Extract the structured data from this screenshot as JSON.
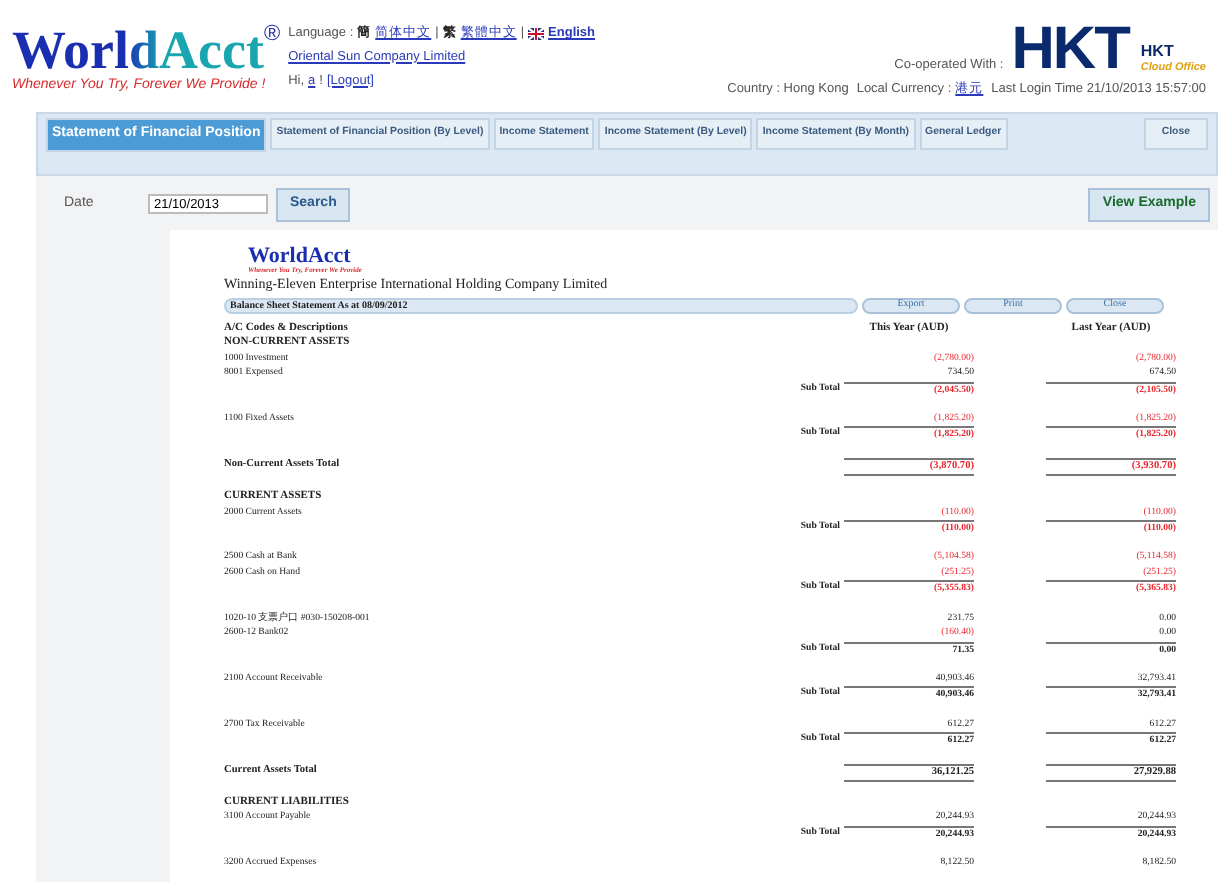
{
  "header": {
    "logo": "WorldAcct",
    "logo_mark": "®",
    "tagline": "Whenever You Try, Forever We Provide !",
    "language_label": "Language :",
    "languages": [
      {
        "glyph": "簡",
        "label": "简体中文",
        "selected": false
      },
      {
        "separator": "|",
        "glyph": "繁",
        "label": "繁體中文",
        "selected": false
      },
      {
        "separator": "|",
        "label": "English",
        "selected": true
      }
    ],
    "company": "Oriental Sun Company Limited",
    "greeting": "Hi,",
    "user": "a",
    "greeting_end": "!",
    "logout": "[Logout]",
    "cooperated": "Co-operated With :",
    "partner_logo": "HKT",
    "partner_sub": "HKT",
    "partner_sub2": "Cloud Office",
    "country": "Country : Hong Kong",
    "currency_label": "Local Currency :",
    "currency": "港元",
    "last_login": "Last Login Time 21/10/2013 15:57:00"
  },
  "tabs": [
    {
      "label": "Statement of Financial Position",
      "selected": true
    },
    {
      "label": "Statement of Financial Position (By Level)",
      "selected": false
    },
    {
      "label": "Income Statement",
      "selected": false
    },
    {
      "label": "Income Statement (By Level)",
      "selected": false
    },
    {
      "label": "Income Statement (By Month)",
      "selected": false
    },
    {
      "label": "General Ledger",
      "selected": false
    }
  ],
  "close_tab": "Close",
  "filter": {
    "label": "Date",
    "value": "21/10/2013",
    "search": "Search",
    "example": "View Example"
  },
  "report": {
    "logo": "WorldAcct",
    "tagline": "Whenever You Try, Forever We Provide",
    "company": "Winning-Eleven Enterprise International Holding Company Limited",
    "title": "Balance Sheet Statement As at 08/09/2012",
    "buttons": [
      "Export",
      "Print",
      "Close"
    ],
    "col_label": "A/C Codes & Descriptions",
    "col_this": "This Year  (AUD)",
    "col_last": "Last Year  (AUD)",
    "rows": [
      {
        "kind": "heading",
        "label": "NON-CURRENT ASSETS"
      },
      {
        "kind": "line",
        "label": "1000 Investment",
        "this_year": {
          "text": "(2,780.00)",
          "negative": true
        },
        "last_year": {
          "text": "(2,780.00)",
          "negative": true
        }
      },
      {
        "kind": "line",
        "label": "8001 Expensed",
        "this_year": {
          "text": "734.50",
          "negative": false
        },
        "last_year": {
          "text": "674.50",
          "negative": false
        }
      },
      {
        "kind": "subtotal",
        "label": "Sub Total",
        "this_year": {
          "text": "(2,045.50)",
          "negative": true
        },
        "last_year": {
          "text": "(2,105.50)",
          "negative": true
        }
      },
      {
        "kind": "line",
        "label": "1100 Fixed Assets",
        "this_year": {
          "text": "(1,825.20)",
          "negative": true
        },
        "last_year": {
          "text": "(1,825.20)",
          "negative": true
        }
      },
      {
        "kind": "subtotal",
        "label": "Sub Total",
        "this_year": {
          "text": "(1,825.20)",
          "negative": true
        },
        "last_year": {
          "text": "(1,825.20)",
          "negative": true
        }
      },
      {
        "kind": "total",
        "label": "Non-Current Assets Total",
        "this_year": {
          "text": "(3,870.70)",
          "negative": true
        },
        "last_year": {
          "text": "(3,930.70)",
          "negative": true
        }
      },
      {
        "kind": "heading",
        "label": "CURRENT ASSETS"
      },
      {
        "kind": "line",
        "label": "2000 Current Assets",
        "this_year": {
          "text": "(110.00)",
          "negative": true
        },
        "last_year": {
          "text": "(110.00)",
          "negative": true
        }
      },
      {
        "kind": "subtotal",
        "label": "Sub Total",
        "this_year": {
          "text": "(110.00)",
          "negative": true
        },
        "last_year": {
          "text": "(110.00)",
          "negative": true
        }
      },
      {
        "kind": "line",
        "label": "2500 Cash at Bank",
        "this_year": {
          "text": "(5,104.58)",
          "negative": true
        },
        "last_year": {
          "text": "(5,114.58)",
          "negative": true
        }
      },
      {
        "kind": "line",
        "label": "2600 Cash on Hand",
        "this_year": {
          "text": "(251.25)",
          "negative": true
        },
        "last_year": {
          "text": "(251.25)",
          "negative": true
        }
      },
      {
        "kind": "subtotal",
        "label": "Sub Total",
        "this_year": {
          "text": "(5,355.83)",
          "negative": true
        },
        "last_year": {
          "text": "(5,365.83)",
          "negative": true
        }
      },
      {
        "kind": "line",
        "label": "1020-10 支票户口 #030-150208-001",
        "this_year": {
          "text": "231.75",
          "negative": false
        },
        "last_year": {
          "text": "0.00",
          "negative": false
        }
      },
      {
        "kind": "line",
        "label": "2600-12 Bank02",
        "this_year": {
          "text": "(160.40)",
          "negative": true
        },
        "last_year": {
          "text": "0.00",
          "negative": false
        }
      },
      {
        "kind": "subtotal",
        "label": "Sub Total",
        "this_year": {
          "text": "71.35",
          "negative": false
        },
        "last_year": {
          "text": "0.00",
          "negative": false
        }
      },
      {
        "kind": "line",
        "label": "2100 Account Receivable",
        "this_year": {
          "text": "40,903.46",
          "negative": false
        },
        "last_year": {
          "text": "32,793.41",
          "negative": false
        }
      },
      {
        "kind": "subtotal",
        "label": "Sub Total",
        "this_year": {
          "text": "40,903.46",
          "negative": false
        },
        "last_year": {
          "text": "32,793.41",
          "negative": false
        }
      },
      {
        "kind": "line",
        "label": "2700 Tax Receivable",
        "this_year": {
          "text": "612.27",
          "negative": false
        },
        "last_year": {
          "text": "612.27",
          "negative": false
        }
      },
      {
        "kind": "subtotal",
        "label": "Sub Total",
        "this_year": {
          "text": "612.27",
          "negative": false
        },
        "last_year": {
          "text": "612.27",
          "negative": false
        }
      },
      {
        "kind": "total",
        "label": "Current Assets Total",
        "this_year": {
          "text": "36,121.25",
          "negative": false
        },
        "last_year": {
          "text": "27,929.88",
          "negative": false
        }
      },
      {
        "kind": "heading",
        "label": "CURRENT LIABILITIES"
      },
      {
        "kind": "line",
        "label": "3100 Account Payable",
        "this_year": {
          "text": "20,244.93",
          "negative": false
        },
        "last_year": {
          "text": "20,244.93",
          "negative": false
        }
      },
      {
        "kind": "subtotal",
        "label": "Sub Total",
        "this_year": {
          "text": "20,244.93",
          "negative": false
        },
        "last_year": {
          "text": "20,244.93",
          "negative": false
        }
      },
      {
        "kind": "line",
        "label": "3200 Accrued Expenses",
        "this_year": {
          "text": "8,122.50",
          "negative": false
        },
        "last_year": {
          "text": "8,182.50",
          "negative": false
        }
      }
    ]
  }
}
